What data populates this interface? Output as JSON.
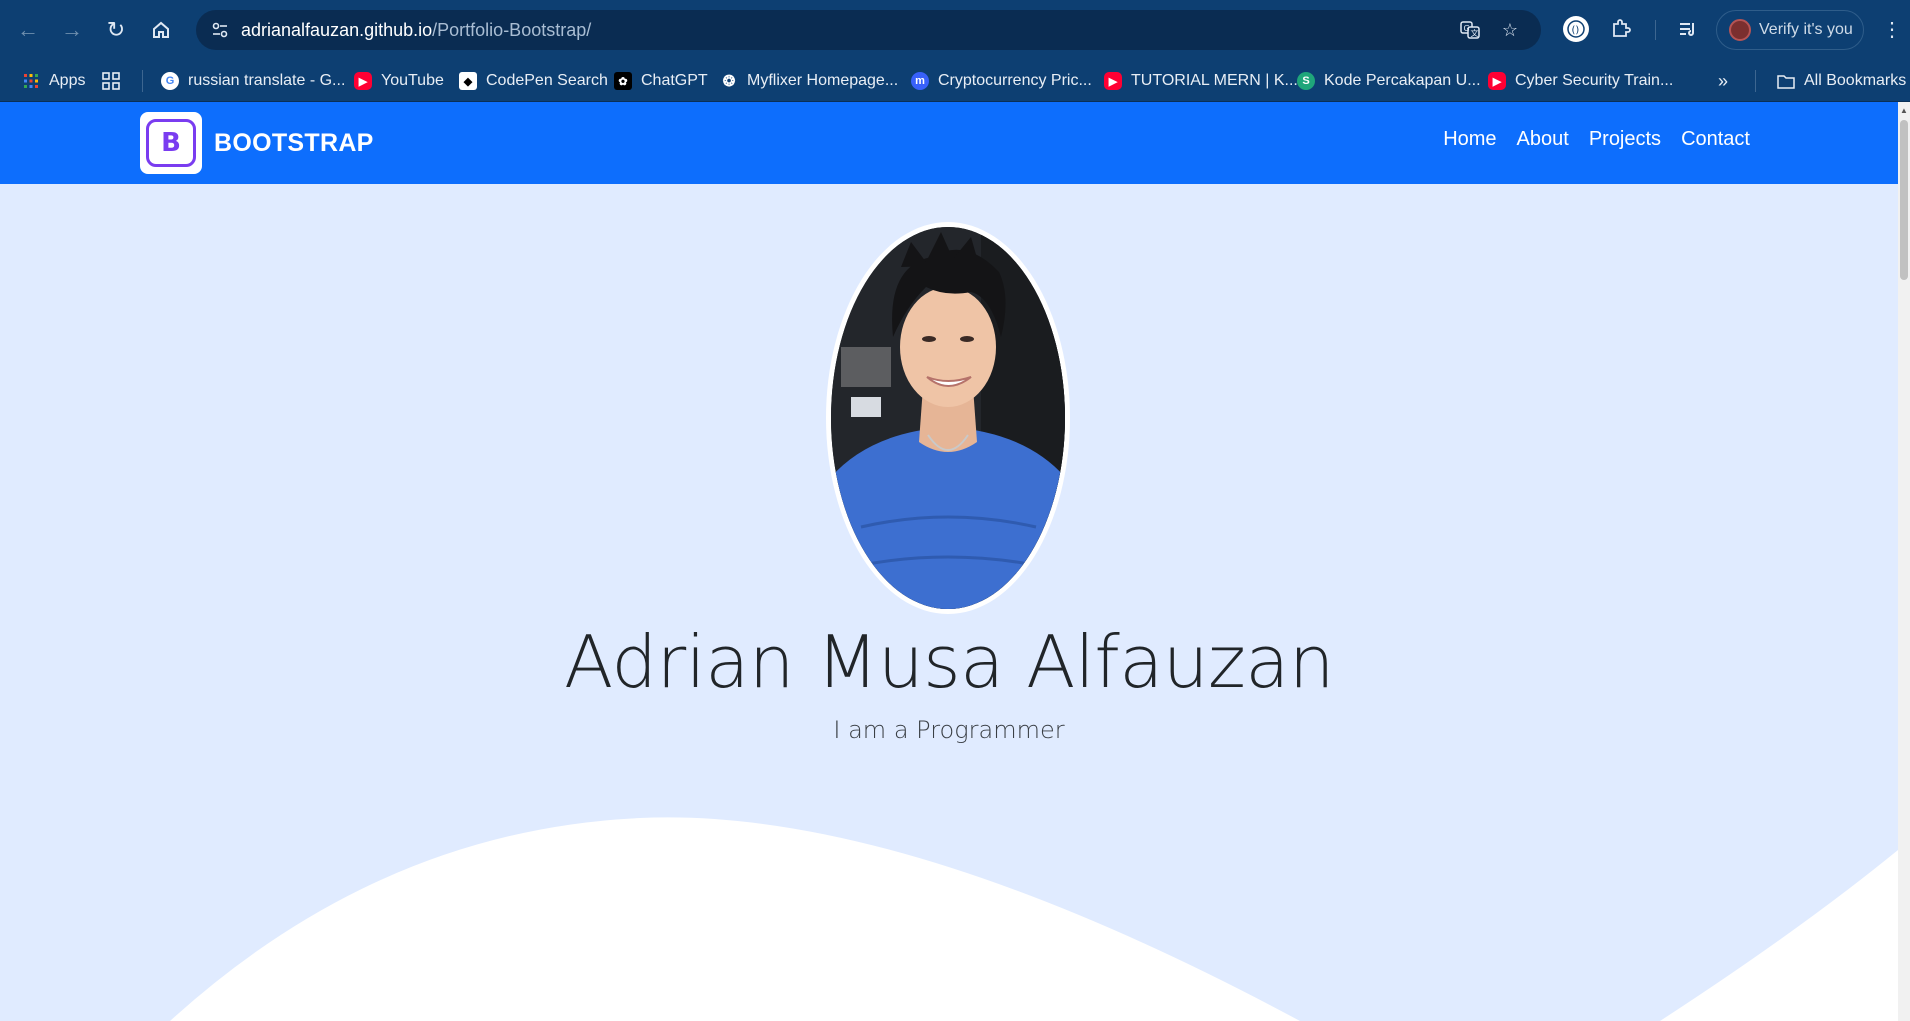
{
  "browser": {
    "url_host": "adrianalfauzan.github.io",
    "url_path": "/Portfolio-Bootstrap/",
    "profile_label": "Verify it's you",
    "bookmarks": [
      {
        "label": "Apps",
        "icon": "apps-grid-icon"
      },
      {
        "label": "",
        "icon": "tab-groups-icon"
      },
      {
        "label": "russian translate - G...",
        "icon": "google-icon"
      },
      {
        "label": "YouTube",
        "icon": "youtube-icon"
      },
      {
        "label": "CodePen Search",
        "icon": "codepen-icon"
      },
      {
        "label": "ChatGPT",
        "icon": "chatgpt-icon"
      },
      {
        "label": "Myflixer Homepage...",
        "icon": "film-reel-icon"
      },
      {
        "label": "Cryptocurrency Pric...",
        "icon": "coinmarketcap-icon"
      },
      {
        "label": "TUTORIAL MERN | K...",
        "icon": "youtube-icon"
      },
      {
        "label": "Kode Percakapan U...",
        "icon": "site-icon"
      },
      {
        "label": "Cyber Security Train...",
        "icon": "youtube-icon"
      }
    ],
    "all_bookmarks_label": "All Bookmarks"
  },
  "navbar": {
    "brand": "BOOTSTRAP",
    "brand_logo_letter": "B",
    "links": [
      "Home",
      "About",
      "Projects",
      "Contact"
    ]
  },
  "hero": {
    "name": "Adrian Musa Alfauzan",
    "tagline": "I am a Programmer"
  },
  "colors": {
    "primary": "#0d6efd",
    "hero_bg": "#e0ebff",
    "chrome_bg": "#0d3f72"
  }
}
